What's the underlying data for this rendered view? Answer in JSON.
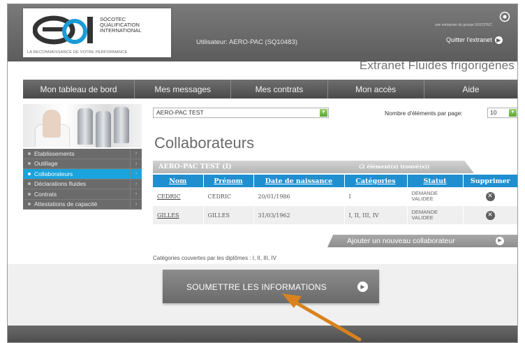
{
  "header": {
    "logo": {
      "line1": "SOCOTEC",
      "line2": "QUALIFICATION",
      "line3": "INTERNATIONAL",
      "tagline": "LA RECONNAISSANCE DE VOTRE PERFORMANCE"
    },
    "user_label": "Utilisateur: AERO-PAC (SQ10483)",
    "group_text": "une entreprise du groupe SOCOTEC",
    "quit_label": "Quitter l'extranet",
    "site_title": "Extranet Fluides frigorigènes"
  },
  "nav": {
    "items": [
      {
        "label": "Mon tableau de bord"
      },
      {
        "label": "Mes messages"
      },
      {
        "label": "Mes contrats"
      },
      {
        "label": "Mon accès"
      },
      {
        "label": "Aide"
      }
    ]
  },
  "sidebar": {
    "items": [
      {
        "label": "Etablissements",
        "active": false
      },
      {
        "label": "Outillage",
        "active": false
      },
      {
        "label": "Collaborateurs",
        "active": true
      },
      {
        "label": "Déclarations fluides",
        "active": false
      },
      {
        "label": "Contrats",
        "active": false
      },
      {
        "label": "Attestations de capacité",
        "active": false
      }
    ]
  },
  "company_select": {
    "value": "AERO-PAC TEST"
  },
  "per_page": {
    "label": "Nombre d'éléments par page:",
    "value": "10"
  },
  "page_title": "Collaborateurs",
  "grid": {
    "company": "AERO-PAC TEST   (I)",
    "found": "(2 élément(s) trouvé(s))",
    "columns": [
      "Nom",
      "Prénom",
      "Date de naissance",
      "Catégories",
      "Statut",
      "Supprimer"
    ],
    "rows": [
      {
        "nom": "CEDRIC",
        "prenom": "CEDRIC",
        "date": "20/01/1986",
        "categories": "I",
        "statut": [
          "DEMANDE",
          "VALIDEE"
        ]
      },
      {
        "nom": "GILLES",
        "prenom": "GILLES",
        "date": "31/03/1962",
        "categories": "I, II, III, IV",
        "statut": [
          "DEMANDE",
          "VALIDEE"
        ]
      }
    ]
  },
  "add_button": {
    "label": "Ajouter un nouveau collaborateur"
  },
  "categories_note": "Catégories couvertes par les diplômes  :  I, II, III, IV",
  "submit_button": {
    "label": "SOUMETTRE LES INFORMATIONS"
  },
  "colors": {
    "accent": "#1f8fd0",
    "sidebar_active": "#1aa3dc",
    "nav_bg": "#555555",
    "annotation_arrow": "#d9821e",
    "select_button": "#6bb83e"
  },
  "icons": {
    "quit": "arrow-circle-right-icon",
    "delete": "close-circle-icon",
    "add": "arrow-circle-right-icon",
    "submit": "arrow-circle-right-icon",
    "select": "chevron-down-icon"
  }
}
